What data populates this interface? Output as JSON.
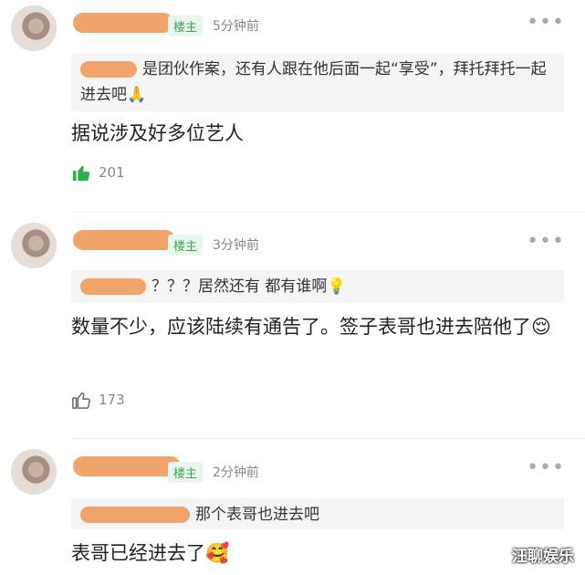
{
  "comments": [
    {
      "owner_badge": "楼主",
      "time": "5分钟前",
      "quote_text": "是团伙作案，还有人跟在他后面一起“享受”，拜托拜托一起进去吧🙏",
      "text": "据说涉及好多位艺人",
      "likes": "201",
      "liked": true
    },
    {
      "owner_badge": "楼主",
      "time": "3分钟前",
      "quote_text": "？？？居然还有 都有谁啊💡",
      "text": "数量不少，应该陆续有通告了。签子表哥也进去陪他了😌",
      "likes": "173",
      "liked": false
    },
    {
      "owner_badge": "楼主",
      "time": "2分钟前",
      "quote_text": "那个表哥也进去吧",
      "text": "表哥已经进去了🥰"
    }
  ],
  "more_glyph": "•••",
  "watermark": "汪聊娱乐",
  "colors": {
    "liked_icon": "#2fae4e",
    "unliked_icon": "#666666",
    "owner_badge": "#3aa35b"
  }
}
